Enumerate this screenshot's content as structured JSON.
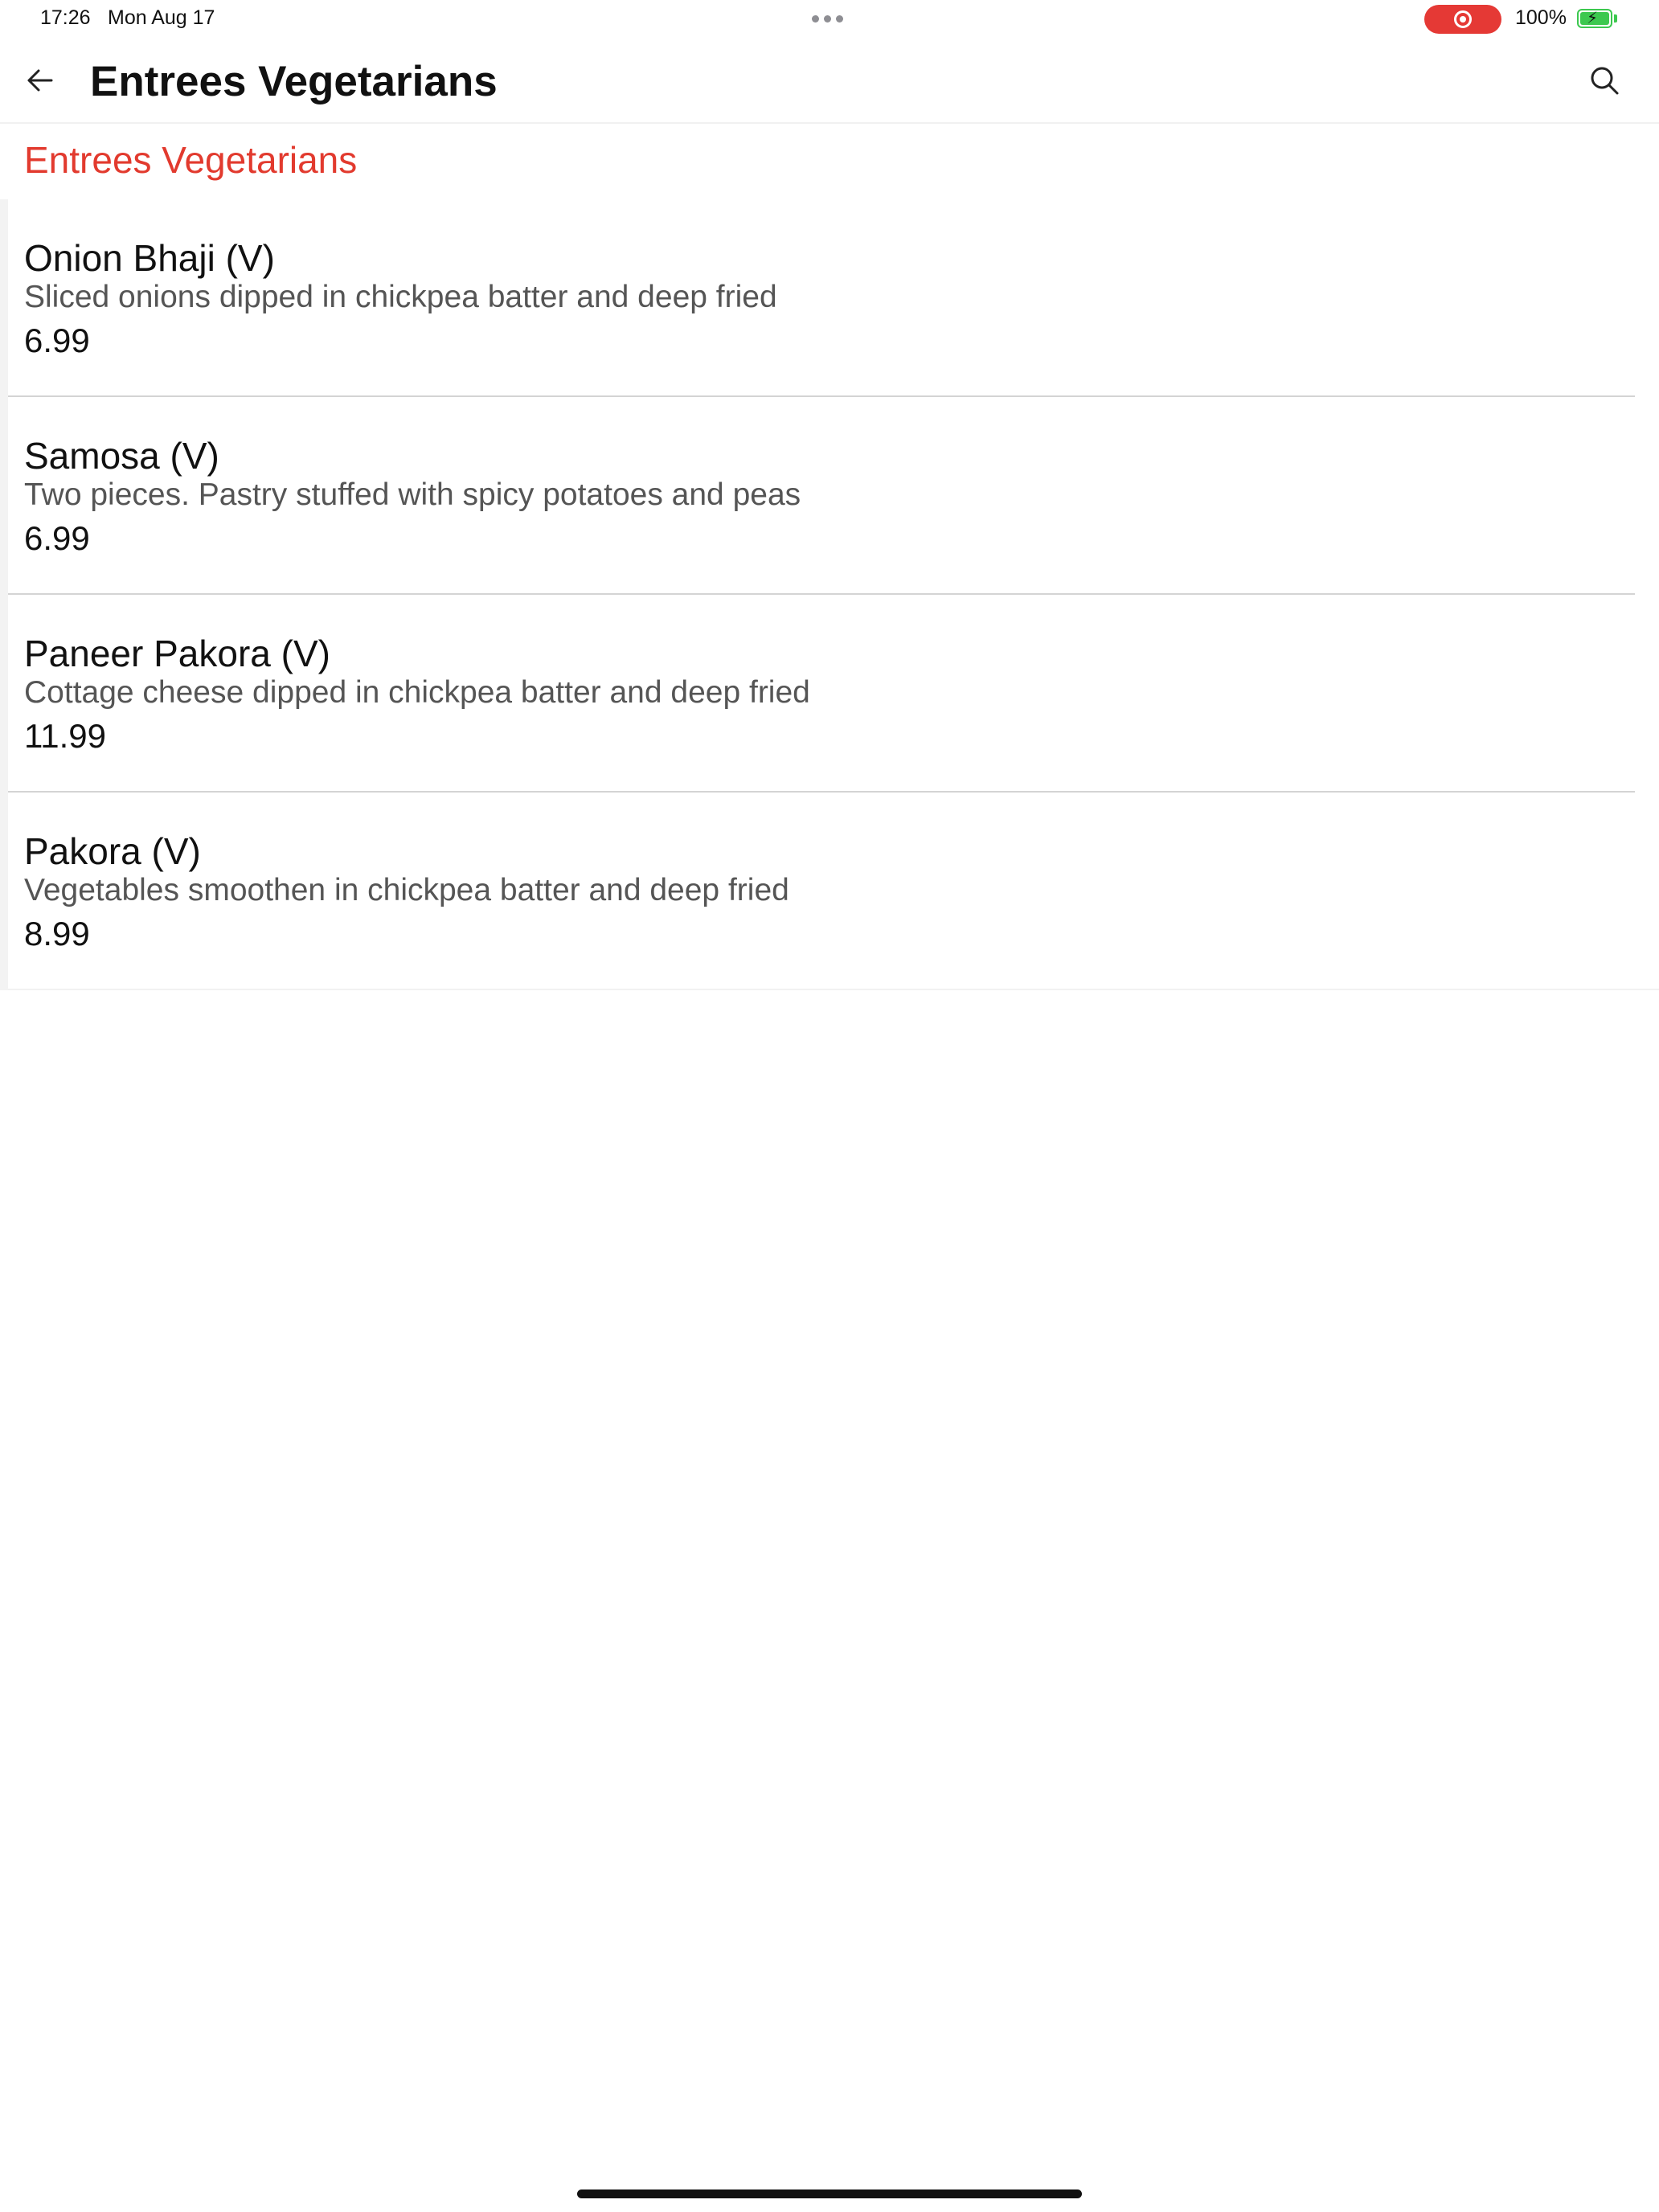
{
  "status_bar": {
    "time": "17:26",
    "date": "Mon Aug 17",
    "battery_percent": "100%",
    "battery_level": 1.0,
    "record_color": "#e53935",
    "battery_color": "#3cc84f"
  },
  "app_bar": {
    "title": "Entrees Vegetarians",
    "back_icon": "arrow-left-icon",
    "search_icon": "search-icon"
  },
  "category": {
    "title": "Entrees  Vegetarians",
    "accent_color": "#e23a2e"
  },
  "menu_items": [
    {
      "name": "Onion Bhaji (V)",
      "description": "Sliced onions dipped in chickpea batter and deep fried",
      "price": "6.99"
    },
    {
      "name": "Samosa (V)",
      "description": "Two pieces. Pastry stuffed with spicy potatoes and peas",
      "price": "6.99"
    },
    {
      "name": "Paneer Pakora (V)",
      "description": "Cottage cheese dipped in chickpea batter and deep fried",
      "price": "11.99"
    },
    {
      "name": "Pakora (V)",
      "description": "Vegetables smoothen in chickpea batter and deep fried",
      "price": "8.99"
    }
  ]
}
